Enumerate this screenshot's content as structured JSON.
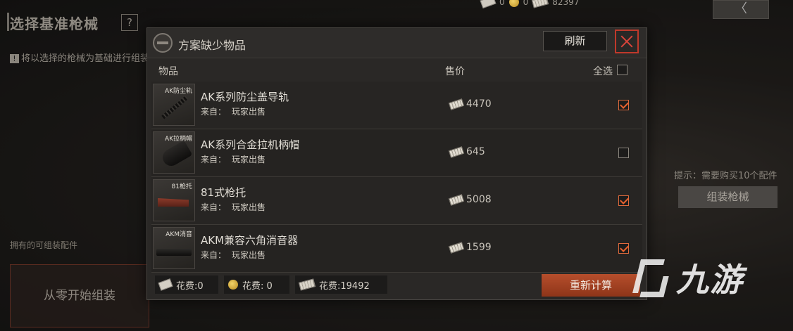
{
  "background": {
    "title": "选择基准枪械",
    "help": "?",
    "hint": "将以选择的枪械为基础进行组装",
    "owned_label": "拥有的可组装配件",
    "scratch_button": "从零开始组装",
    "tip": "提示：需要购买10个配件",
    "assemble_button": "组装枪械",
    "back": "〈",
    "currency": {
      "bills": "0",
      "coins": "0",
      "cash": "82397"
    }
  },
  "modal": {
    "title": "方案缺少物品",
    "refresh_label": "刷新",
    "columns": {
      "item": "物品",
      "price": "售价",
      "select_all": "全选"
    },
    "select_all_checked": false,
    "items": [
      {
        "thumb_label": "AK防尘轨",
        "name": "AK系列防尘盖导轨",
        "source_label": "来自：",
        "source": "玩家出售",
        "price": "4470",
        "checked": true
      },
      {
        "thumb_label": "AK拉柄帽",
        "name": "AK系列合金拉机柄帽",
        "source_label": "来自：",
        "source": "玩家出售",
        "price": "645",
        "checked": false
      },
      {
        "thumb_label": "81枪托",
        "name": "81式枪托",
        "source_label": "来自：",
        "source": "玩家出售",
        "price": "5008",
        "checked": true
      },
      {
        "thumb_label": "AKM消音",
        "name": "AKM兼容六角消音器",
        "source_label": "来自：",
        "source": "玩家出售",
        "price": "1599",
        "checked": true
      }
    ],
    "footer": {
      "cost_bills": "花费:0",
      "cost_coins": "花费: 0",
      "cost_cash": "花费:19492",
      "recalc_label": "重新计算"
    }
  },
  "watermark": {
    "text": "九游"
  },
  "colors": {
    "accent": "#e8622e",
    "button": "#a8421f",
    "close": "#c0392b"
  }
}
